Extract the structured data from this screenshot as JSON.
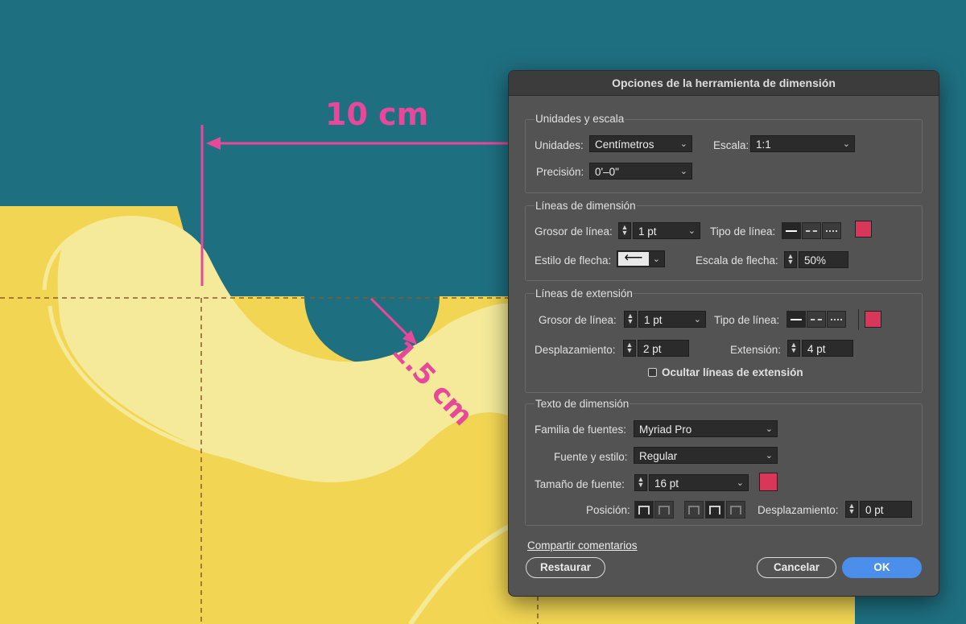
{
  "artwork": {
    "label_width": "10 cm",
    "label_radius": "1.5 cm",
    "colors": {
      "background": "#1e6f80",
      "yellow": "#f2d653",
      "light_yellow": "#f4ea9a",
      "dimension": "#e8489a"
    }
  },
  "dialog": {
    "title": "Opciones de la herramienta de dimensión",
    "units_scale": {
      "title": "Unidades y escala",
      "units_label": "Unidades:",
      "units_value": "Centímetros",
      "scale_label": "Escala:",
      "scale_value": "1:1",
      "precision_label": "Precisión:",
      "precision_value": "0'–0\""
    },
    "dimension_lines": {
      "title": "Líneas de dimensión",
      "weight_label": "Grosor de línea:",
      "weight_value": "1 pt",
      "type_label": "Tipo de línea:",
      "arrow_style_label": "Estilo de flecha:",
      "arrow_scale_label": "Escala de flecha:",
      "arrow_scale_value": "50%",
      "color": "#d9375a"
    },
    "extension_lines": {
      "title": "Líneas de extensión",
      "weight_label": "Grosor de línea:",
      "weight_value": "1 pt",
      "type_label": "Tipo de línea:",
      "offset_label": "Desplazamiento:",
      "offset_value": "2 pt",
      "extension_label": "Extensión:",
      "extension_value": "4 pt",
      "hide_label": "Ocultar líneas de extensión",
      "hide_checked": false,
      "color": "#d9375a"
    },
    "dimension_text": {
      "title": "Texto de dimensión",
      "family_label": "Familia de fuentes:",
      "family_value": "Myriad Pro",
      "style_label": "Fuente y estilo:",
      "style_value": "Regular",
      "size_label": "Tamaño de fuente:",
      "size_value": "16 pt",
      "position_label": "Posición:",
      "offset_label": "Desplazamiento:",
      "offset_value": "0 pt",
      "color": "#d9375a"
    },
    "share_feedback": "Compartir comentarios",
    "buttons": {
      "reset": "Restaurar",
      "cancel": "Cancelar",
      "ok": "OK"
    },
    "icons": [
      "chevron-down-icon",
      "spinner-icon",
      "arrow-left-icon",
      "solid-line-icon",
      "dashed-line-icon",
      "dotted-line-icon",
      "text-position-icon"
    ]
  }
}
